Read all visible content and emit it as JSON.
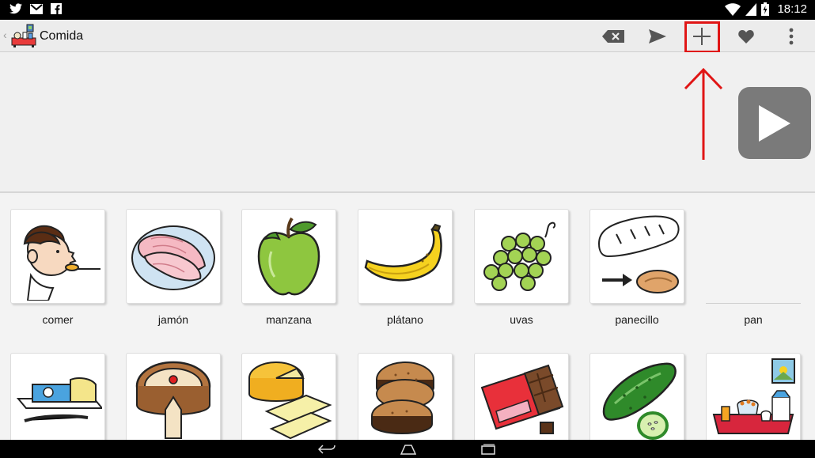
{
  "status_bar": {
    "time": "18:12",
    "left_icons": [
      "twitter-icon",
      "gmail-icon",
      "facebook-icon"
    ],
    "right_icons": [
      "wifi-icon",
      "signal-icon",
      "battery-icon"
    ]
  },
  "action_bar": {
    "title": "Comida",
    "actions": [
      "backspace-icon",
      "send-icon",
      "add-icon",
      "heart-icon",
      "overflow-menu-icon"
    ]
  },
  "annotation": {
    "highlight_color": "#e01515"
  },
  "pictograms": [
    {
      "label": "comer"
    },
    {
      "label": "jamón"
    },
    {
      "label": "manzana"
    },
    {
      "label": "plátano"
    },
    {
      "label": "uvas"
    },
    {
      "label": "panecillo"
    },
    {
      "label": "pan"
    },
    {
      "label": ""
    },
    {
      "label": ""
    },
    {
      "label": ""
    },
    {
      "label": ""
    },
    {
      "label": ""
    },
    {
      "label": ""
    },
    {
      "label": ""
    }
  ],
  "colors": {
    "play_button": "#7a7a7a",
    "background": "#f2f2f2"
  }
}
